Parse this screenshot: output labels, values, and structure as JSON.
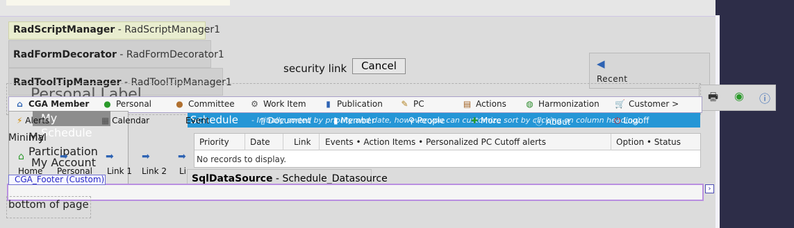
{
  "managers": {
    "script": {
      "name": "RadScriptManager",
      "id": "RadScriptManager1"
    },
    "form": {
      "name": "RadFormDecorator",
      "id": "RadFormDecorator1"
    },
    "tooltip": {
      "name": "RadToolTipManager",
      "id": "RadToolTipManager1"
    }
  },
  "security_link": "security link",
  "cancel_label": "Cancel",
  "recent_label": "Recent",
  "personal_label": "Personal Label",
  "menu": {
    "items": [
      {
        "label": "CGA Member",
        "icon": "home-icon"
      },
      {
        "label": "Personal",
        "icon": "person-icon"
      },
      {
        "label": "Committee",
        "icon": "group-icon"
      },
      {
        "label": "Work Item",
        "icon": "gear-icon"
      },
      {
        "label": "Publication",
        "icon": "book-icon"
      },
      {
        "label": "PC",
        "icon": "edit-icon"
      },
      {
        "label": "Actions",
        "icon": "clipboard-icon"
      },
      {
        "label": "Harmonization",
        "icon": "globe-icon"
      },
      {
        "label": "Customer >",
        "icon": "cart-icon"
      }
    ]
  },
  "submenu": {
    "items": [
      {
        "label": "Alerts",
        "icon": "lightning-icon"
      },
      {
        "label": "Calendar",
        "icon": "calendar-icon"
      },
      {
        "label": "Event",
        "icon": "event-icon"
      },
      {
        "label": "Document",
        "icon": "document-icon"
      },
      {
        "label": "Member",
        "icon": "member-icon"
      },
      {
        "label": "People",
        "icon": "people-icon"
      },
      {
        "label": "More",
        "icon": "plus-icon"
      },
      {
        "label": "About",
        "icon": "info-icon"
      },
      {
        "label": "Logoff",
        "icon": "power-icon"
      }
    ]
  },
  "left_nav": {
    "my_schedule": "My Schedule",
    "minimal": "Minimal",
    "my": "My",
    "participation": "Participation",
    "my_account": "My Account",
    "links": [
      "Home",
      "Personal",
      "Link 1",
      "Link 2",
      "Li"
    ]
  },
  "schedule": {
    "title": "Schedule",
    "note": "- Initially sorted by priority and date, however you can customize sort by clicking on column heading)",
    "columns": [
      "Priority",
      "Date",
      "Link",
      "Events • Action Items • Personalized PC Cutoff alerts",
      "Option • Status"
    ],
    "empty_text": "No records to display."
  },
  "datasource": {
    "name": "SqlDataSource",
    "id": "Schedule_Datasource"
  },
  "footer_label": "CGA_Footer (Custom)",
  "bottom_text": "bottom of page",
  "colors": {
    "schedule_bar": "#2596d6",
    "footer_border": "#b98fe0",
    "accent": "#2e63b3"
  }
}
